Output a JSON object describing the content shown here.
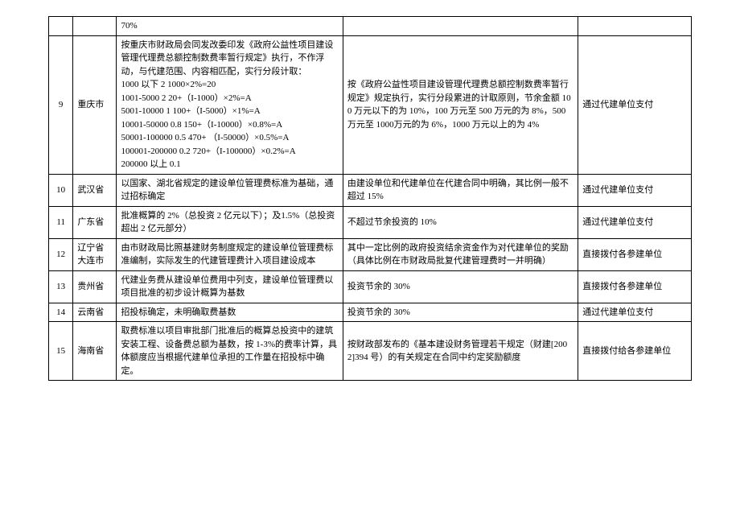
{
  "rows": [
    {
      "idx": "",
      "province": "",
      "basis": "70%",
      "reward": "",
      "payment": ""
    },
    {
      "idx": "9",
      "province": "重庆市",
      "basis": "按重庆市财政局会同发改委印发《政府公益性项目建设管理代理费总额控制数费率暂行规定》执行，不作浮动，与代建范围、内容相匹配，实行分段计取：\n1000 以下 2 1000×2%=20\n1001-5000 2 20+（I-1000）×2%=A\n5001-10000 1 100+（I-5000）×1%=A\n10001-50000 0.8 150+（I-10000）×0.8%=A\n50001-100000 0.5 470+ （I-50000）×0.5%=A\n100001-200000 0.2 720+（I-100000）×0.2%=A\n200000 以上 0.1",
      "reward": "按《政府公益性项目建设管理代理费总额控制数费率暂行规定》规定执行，实行分段累进的计取原则，节余金额 100 万元以下的为 10%，100 万元至 500 万元的为 8%，500 万元至 1000万元的为 6%，1000 万元以上的为 4%",
      "payment": "通过代建单位支付"
    },
    {
      "idx": "10",
      "province": "武汉省",
      "basis": "以国家、湖北省规定的建设单位管理费标准为基础，通过招标确定",
      "reward": "由建设单位和代建单位在代建合同中明确，其比例一般不超过 15%",
      "payment": "通过代建单位支付"
    },
    {
      "idx": "11",
      "province": "广东省",
      "basis": "批准概算的 2%（总投资 2 亿元以下）；及1.5%（总投资超出 2 亿元部分）",
      "reward": "不超过节余投资的 10%",
      "payment": "通过代建单位支付"
    },
    {
      "idx": "12",
      "province": "辽宁省\n大连市",
      "basis": "由市财政局比照基建财务制度规定的建设单位管理费标准编制，实际发生的代建管理费计入项目建设成本",
      "reward": "其中一定比例的政府投资结余资金作为对代建单位的奖励（具体比例在市财政局批复代建管理费时一并明确）",
      "payment": "直接拨付各参建单位"
    },
    {
      "idx": "13",
      "province": "贵州省",
      "basis": "代建业务费从建设单位费用中列支，建设单位管理费以项目批准的初步设计概算为基数",
      "reward": "投资节余的 30%",
      "payment": "直接拨付各参建单位"
    },
    {
      "idx": "14",
      "province": "云南省",
      "basis": "招投标确定，未明确取费基数",
      "reward": "投资节余的 30%",
      "payment": "通过代建单位支付"
    },
    {
      "idx": "15",
      "province": "海南省",
      "basis": "取费标准以项目审批部门批准后的概算总投资中的建筑安装工程、设备费总额为基数，按 1-3%的费率计算，具体额度应当根据代建单位承担的工作量在招投标中确定。",
      "reward": "按财政部发布的《基本建设财务管理若干规定（财建[2002]394 号）的有关规定在合同中约定奖励额度",
      "payment": "直接拨付给各参建单位"
    }
  ]
}
